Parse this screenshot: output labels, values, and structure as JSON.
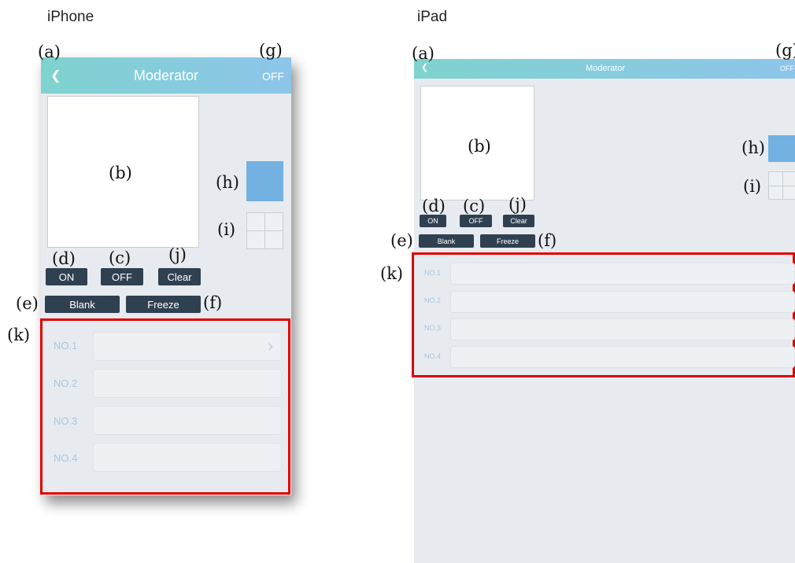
{
  "labels": {
    "iphone": "iPhone",
    "ipad": "iPad"
  },
  "annotations": {
    "a": "(a)",
    "b": "(b)",
    "c": "(c)",
    "d": "(d)",
    "e": "(e)",
    "f": "(f)",
    "g": "(g)",
    "h": "(h)",
    "i": "(i)",
    "j": "(j)",
    "k": "(k)"
  },
  "app": {
    "back_icon": "❮",
    "title": "Moderator",
    "status": "OFF",
    "buttons": {
      "on": "ON",
      "off": "OFF",
      "clear": "Clear",
      "blank": "Blank",
      "freeze": "Freeze"
    },
    "rows": [
      {
        "label": "NO.1",
        "has_chevron": true
      },
      {
        "label": "NO.2",
        "has_chevron": false
      },
      {
        "label": "NO.3",
        "has_chevron": false
      },
      {
        "label": "NO.4",
        "has_chevron": false
      }
    ],
    "chevron": "›"
  },
  "colors": {
    "nav_gradient_start": "#7fd3cf",
    "nav_gradient_end": "#8dc5ea",
    "button_bg": "#2f4051",
    "swatch": "#73b1e2",
    "highlight": "#e00000",
    "screen_bg": "#e7ebef"
  },
  "icons": {
    "back": "chevron-left-icon",
    "row_arrow": "chevron-right-icon"
  }
}
